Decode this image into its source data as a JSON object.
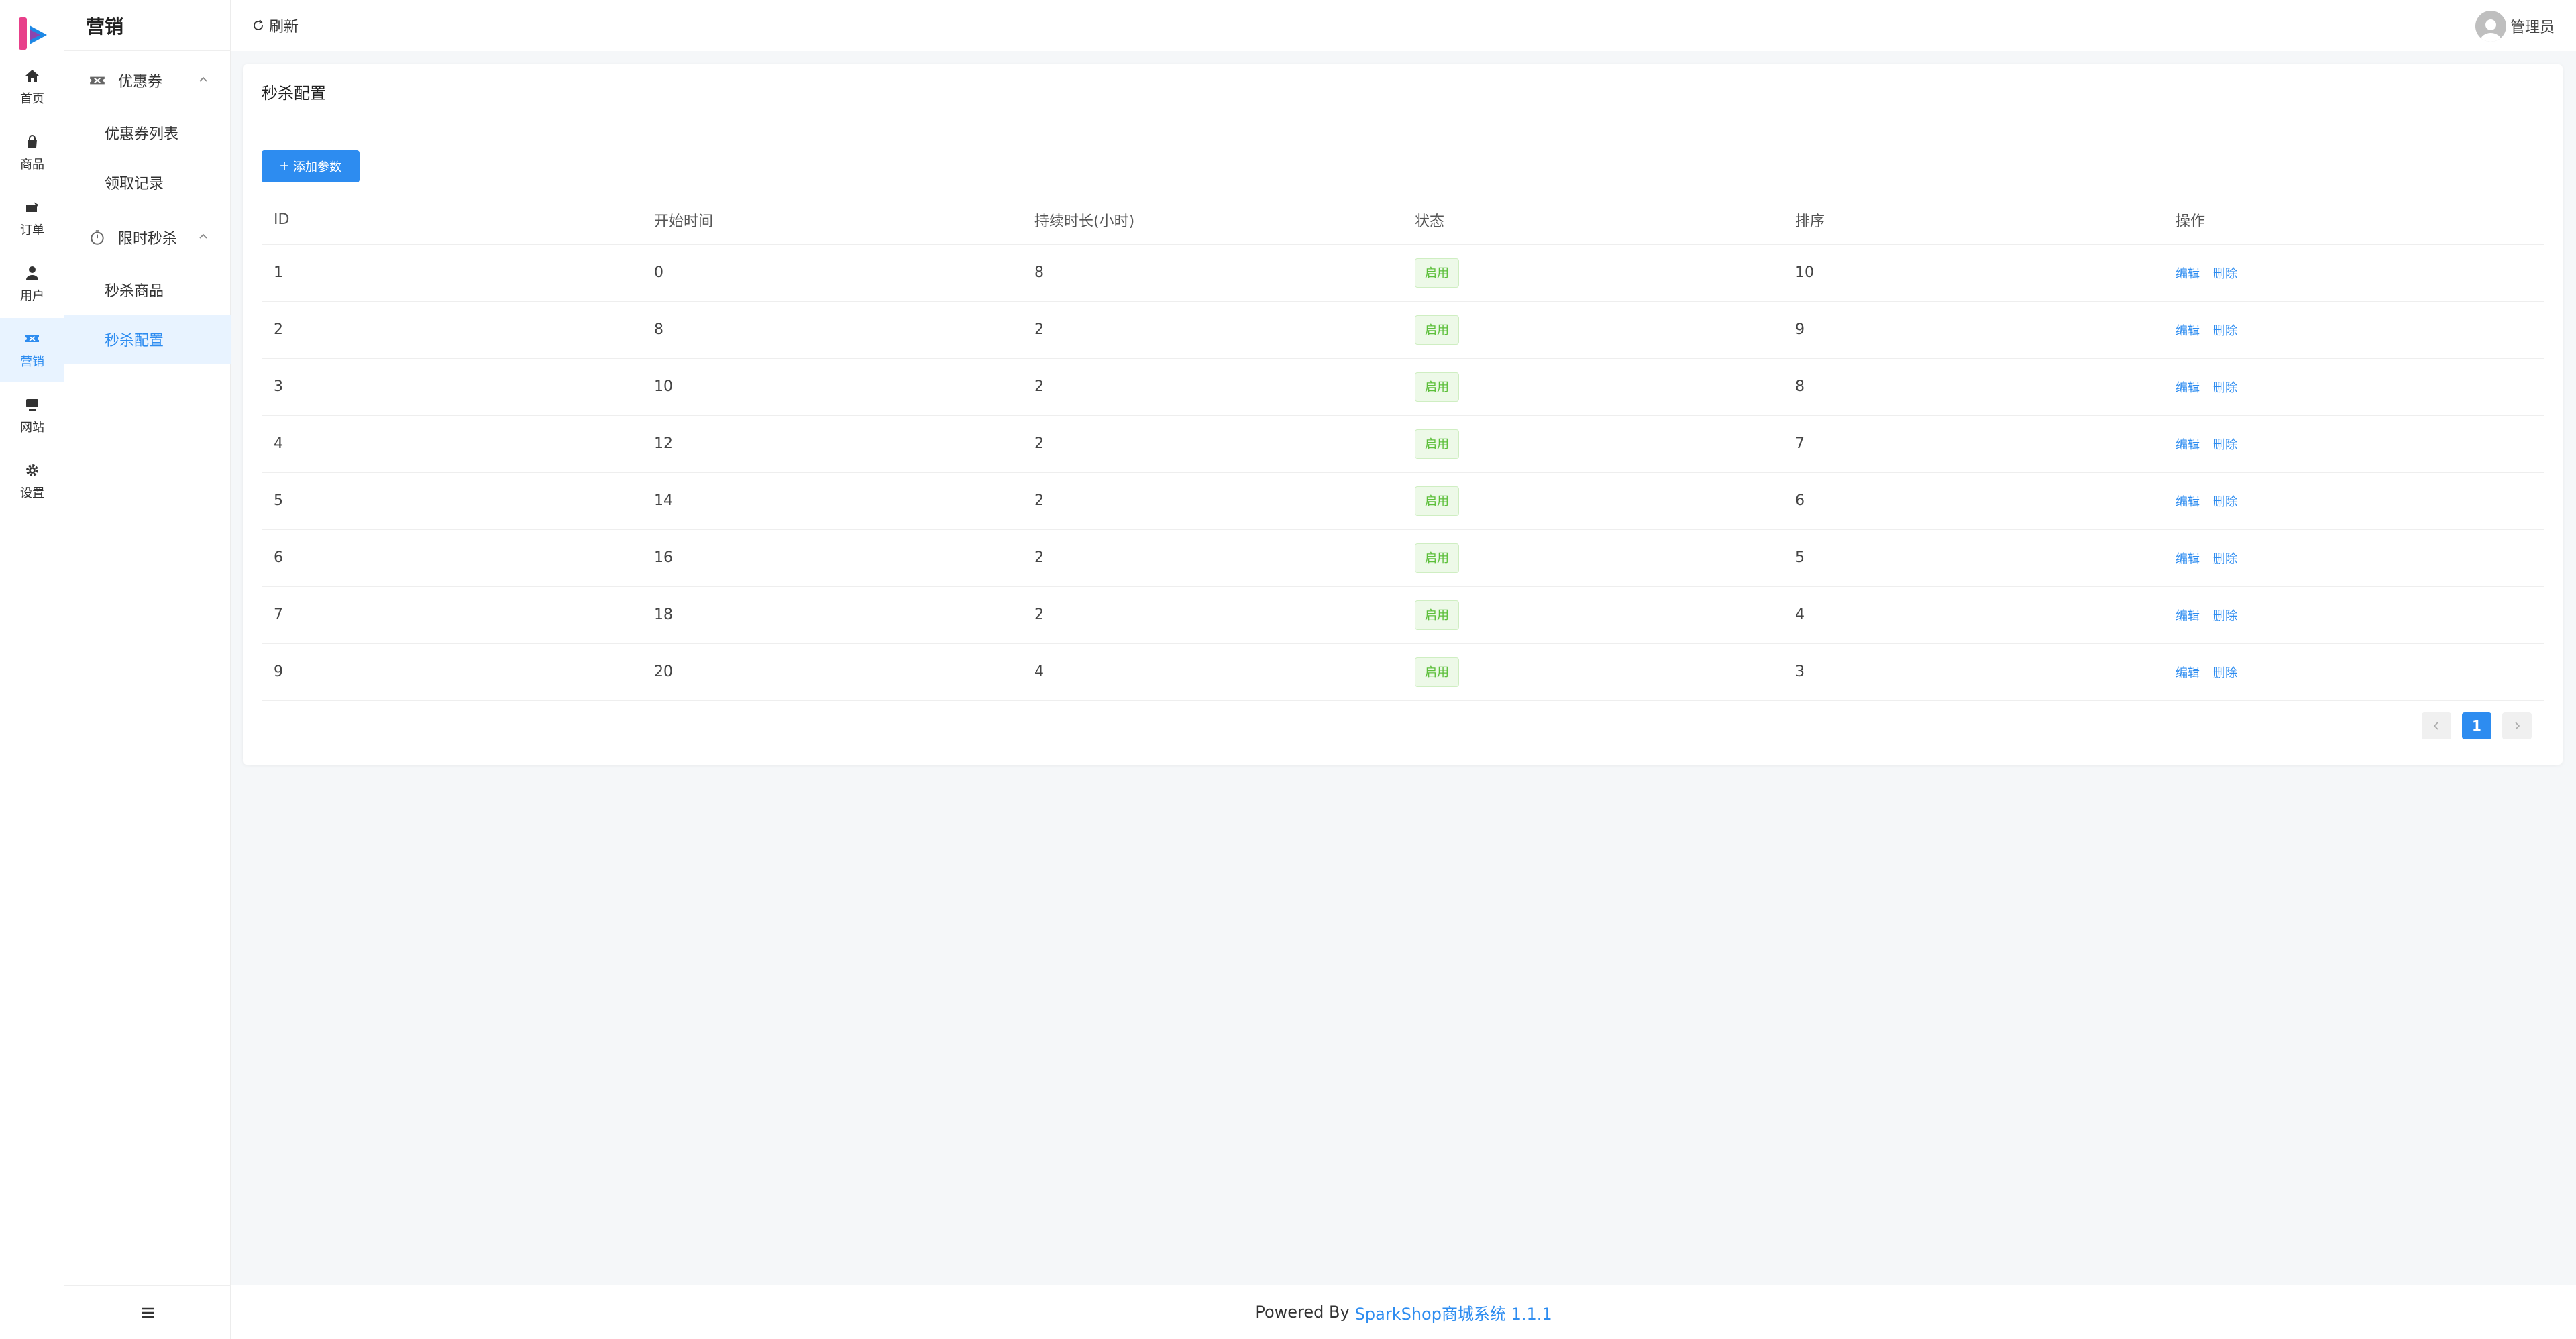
{
  "rail": {
    "items": [
      {
        "label": "首页",
        "icon": "home-icon"
      },
      {
        "label": "商品",
        "icon": "bag-icon"
      },
      {
        "label": "订单",
        "icon": "order-icon"
      },
      {
        "label": "用户",
        "icon": "user-icon"
      },
      {
        "label": "营销",
        "icon": "ticket-icon",
        "active": true
      },
      {
        "label": "网站",
        "icon": "monitor-icon"
      },
      {
        "label": "设置",
        "icon": "gear-icon"
      }
    ]
  },
  "submenu": {
    "title": "营销",
    "group1": {
      "label": "优惠券",
      "icon": "ticket-icon"
    },
    "group1_items": [
      "优惠券列表",
      "领取记录"
    ],
    "group2": {
      "label": "限时秒杀",
      "icon": "stopwatch-icon"
    },
    "group2_items": [
      "秒杀商品",
      "秒杀配置"
    ],
    "active_item": "秒杀配置"
  },
  "header": {
    "refresh_label": "刷新",
    "user_name": "管理员"
  },
  "card": {
    "title": "秒杀配置",
    "add_button": "添加参数"
  },
  "table": {
    "columns": [
      "ID",
      "开始时间",
      "持续时长(小时)",
      "状态",
      "排序",
      "操作"
    ],
    "rows": [
      {
        "id": "1",
        "start": "0",
        "duration": "8",
        "status": "启用",
        "sort": "10"
      },
      {
        "id": "2",
        "start": "8",
        "duration": "2",
        "status": "启用",
        "sort": "9"
      },
      {
        "id": "3",
        "start": "10",
        "duration": "2",
        "status": "启用",
        "sort": "8"
      },
      {
        "id": "4",
        "start": "12",
        "duration": "2",
        "status": "启用",
        "sort": "7"
      },
      {
        "id": "5",
        "start": "14",
        "duration": "2",
        "status": "启用",
        "sort": "6"
      },
      {
        "id": "6",
        "start": "16",
        "duration": "2",
        "status": "启用",
        "sort": "5"
      },
      {
        "id": "7",
        "start": "18",
        "duration": "2",
        "status": "启用",
        "sort": "4"
      },
      {
        "id": "9",
        "start": "20",
        "duration": "4",
        "status": "启用",
        "sort": "3"
      }
    ],
    "actions": {
      "edit": "编辑",
      "delete": "删除"
    }
  },
  "pagination": {
    "current": "1",
    "prev_icon": "chevron-left-icon",
    "next_icon": "chevron-right-icon"
  },
  "footer": {
    "prefix": "Powered By",
    "brand": "SparkShop商城系统 1.1.1"
  },
  "colors": {
    "primary": "#2d8cf0",
    "success_text": "#5cbf3a",
    "success_bg": "#edf9e8",
    "active_bg": "#e8f3ff"
  }
}
